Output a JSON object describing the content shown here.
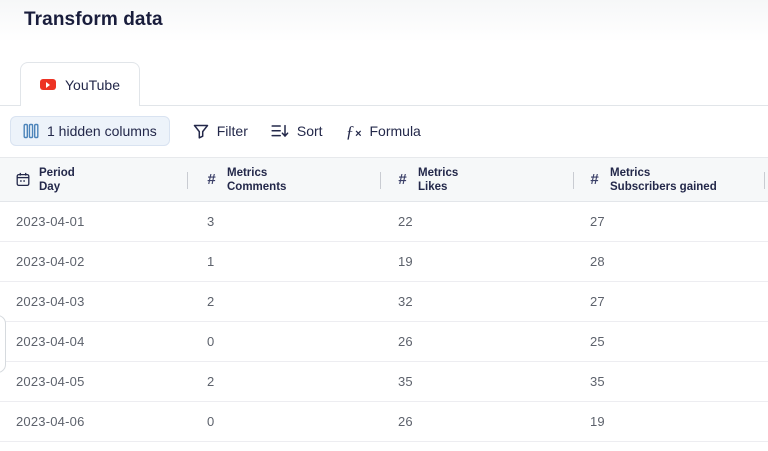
{
  "page": {
    "title": "Transform data"
  },
  "tabs": [
    {
      "label": "YouTube",
      "icon": "youtube-icon",
      "active": true
    }
  ],
  "toolbar": {
    "hidden_columns_label": "1 hidden columns",
    "filter_label": "Filter",
    "sort_label": "Sort",
    "formula_label": "Formula"
  },
  "icons": {
    "hash": "#",
    "formula_f": "ƒ",
    "formula_x": "×"
  },
  "colors": {
    "accent_column_icon_blue": "#4c84ba",
    "youtube_red": "#ed3324",
    "header_navy": "#23284a",
    "row_text_gray": "#5d626c",
    "header_bg": "#f6f8f9",
    "pill_bg": "#edf3fa"
  },
  "table": {
    "columns": [
      {
        "icon": "calendar-icon",
        "group": "Period",
        "name": "Day",
        "type": "date"
      },
      {
        "icon": "hash-icon",
        "group": "Metrics",
        "name": "Comments",
        "type": "number"
      },
      {
        "icon": "hash-icon",
        "group": "Metrics",
        "name": "Likes",
        "type": "number"
      },
      {
        "icon": "hash-icon",
        "group": "Metrics",
        "name": "Subscribers gained",
        "type": "number"
      }
    ],
    "rows": [
      [
        "2023-04-01",
        "3",
        "22",
        "27"
      ],
      [
        "2023-04-02",
        "1",
        "19",
        "28"
      ],
      [
        "2023-04-03",
        "2",
        "32",
        "27"
      ],
      [
        "2023-04-04",
        "0",
        "26",
        "25"
      ],
      [
        "2023-04-05",
        "2",
        "35",
        "35"
      ],
      [
        "2023-04-06",
        "0",
        "26",
        "19"
      ]
    ]
  }
}
